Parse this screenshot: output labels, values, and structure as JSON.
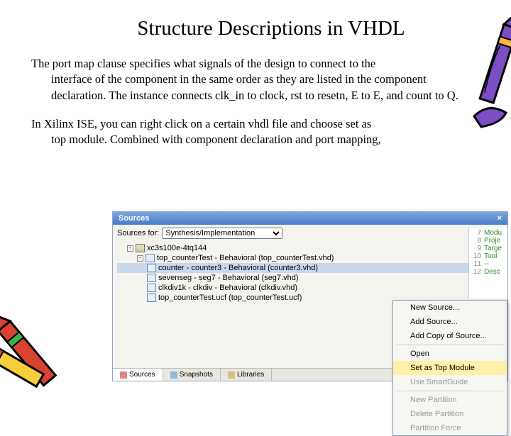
{
  "title": "Structure Descriptions in VHDL",
  "para1_lead": "The port map clause specifies what signals of the design to connect to the",
  "para1_rest": "interface of the component in the same order as they are listed in the component declaration. The instance connects clk_in to clock, rst to resetn, E to E, and count to Q.",
  "para2_lead": "In Xilinx ISE, you can right click on a certain vhdl file and choose set as",
  "para2_rest": "top module. Combined with component declaration and port mapping,",
  "win": {
    "title": "Sources",
    "close": "×",
    "srcfor_label": "Sources for:",
    "srcfor_value": "Synthesis/Implementation"
  },
  "tree": {
    "chip": "xc3s100e-4tq144",
    "top": "top_counterTest - Behavioral (top_counterTest.vhd)",
    "n1": "counter - counter3 - Behavioral (counter3.vhd)",
    "n2": "sevenseg - seg7 - Behavioral (seg7.vhd)",
    "n3": "clkdiv1k - clkdiv - Behavioral (clkdiv.vhd)",
    "n4": "top_counterTest.ucf (top_counterTest.ucf)"
  },
  "tabs": {
    "t1": "Sources",
    "t2": "Snapshots",
    "t3": "Libraries"
  },
  "code": {
    "l7": "Modu",
    "l8": "Proje",
    "l9": "Targe",
    "l10": "Tool",
    "l12": "Desc"
  },
  "menu": {
    "m1": "New Source...",
    "m2": "Add Source...",
    "m3": "Add Copy of Source...",
    "m4": "Open",
    "m5": "Set as Top Module",
    "m6": "Use SmartGuide",
    "m7": "New Partition",
    "m8": "Delete Partition",
    "m9": "Partition Force"
  }
}
